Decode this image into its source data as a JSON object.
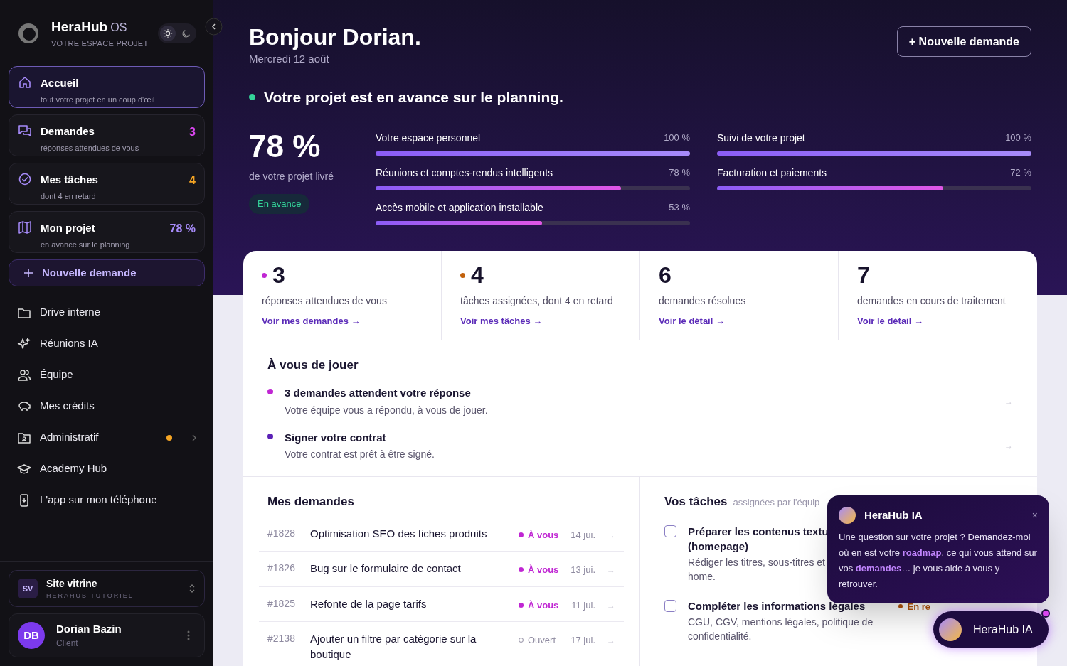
{
  "brand": {
    "name": "HeraHub",
    "suffix": "OS",
    "tagline": "VOTRE ESPACE PROJET"
  },
  "theme_toggle": [
    {
      "selected": true
    },
    {
      "selected": false
    }
  ],
  "nav_cards": [
    {
      "label": "Accueil",
      "sub": "tout votre projet en un coup d'œil",
      "selected": true
    },
    {
      "label": "Demandes",
      "sub": "réponses attendues de vous",
      "badge": "3",
      "color": "#d946ef",
      "selected": false
    },
    {
      "label": "Mes tâches",
      "sub": "dont 4 en retard",
      "badge": "4",
      "color": "#f5a524",
      "selected": false
    },
    {
      "label": "Mon projet",
      "sub": "en avance sur le planning",
      "badge": "78 %",
      "color": "#a78bfa",
      "selected": false
    }
  ],
  "new_request_button": "Nouvelle demande",
  "nav_items": [
    {
      "label": "Drive interne"
    },
    {
      "label": "Réunions IA"
    },
    {
      "label": "Équipe"
    },
    {
      "label": "Mes crédits"
    },
    {
      "label": "Administratif",
      "alert": true
    },
    {
      "label": "Academy Hub"
    },
    {
      "label": "L'app sur mon téléphone"
    }
  ],
  "workspace": {
    "initials": "SV",
    "name": "Site vitrine",
    "sub": "HERAHUB TUTORIEL"
  },
  "user": {
    "initials": "DB",
    "name": "Dorian Bazin",
    "role": "Client"
  },
  "header": {
    "greeting": "Bonjour Dorian.",
    "date": "Mercredi 12 août",
    "action": "+ Nouvelle demande",
    "status": "Votre projet est en avance sur le planning."
  },
  "progress": {
    "value": "78 %",
    "label": "de votre projet livré",
    "badge": "En avance",
    "columns": [
      [
        {
          "name": "Votre espace personnel",
          "reading": "100 %",
          "level": 1
        },
        {
          "name": "Réunions et comptes-rendus intelligents",
          "reading": "78 %",
          "level": 0.78
        },
        {
          "name": "Accès mobile et application installable",
          "reading": "53 %",
          "level": 0.53
        }
      ],
      [
        {
          "name": "Suivi de votre projet",
          "reading": "100 %",
          "level": 1
        },
        {
          "name": "Facturation et paiements",
          "reading": "72 %",
          "level": 0.72
        }
      ]
    ]
  },
  "stats": [
    {
      "value": "3",
      "label": "réponses attendues de vous",
      "link": "Voir mes demandes →",
      "color": "#c026d3"
    },
    {
      "value": "4",
      "label": "tâches assignées, dont 4 en retard",
      "link": "Voir mes tâches →",
      "color": "#c2610c"
    },
    {
      "value": "6",
      "label": "demandes résolues",
      "link": "Voir le détail →"
    },
    {
      "value": "7",
      "label": "demandes en cours de traitement",
      "link": "Voir le détail →"
    }
  ],
  "todo": {
    "title": "À vous de jouer",
    "items": [
      {
        "title": "3 demandes attendent votre réponse",
        "sub": "Votre équipe vous a répondu, à vous de jouer.",
        "color": "#c026d3",
        "arrow": "→"
      },
      {
        "title": "Signer votre contrat",
        "sub": "Votre contrat est prêt à être signé.",
        "color": "#5b21b6",
        "arrow": "→"
      }
    ]
  },
  "requests": {
    "title": "Mes demandes",
    "rows": [
      {
        "id": "#1828",
        "title": "Optimisation SEO des fiches produits",
        "status": "À vous",
        "kind": "mine",
        "date": "14 jui.",
        "arrow": "→"
      },
      {
        "id": "#1826",
        "title": "Bug sur le formulaire de contact",
        "status": "À vous",
        "kind": "mine",
        "date": "13 jui.",
        "arrow": "→"
      },
      {
        "id": "#1825",
        "title": "Refonte de la page tarifs",
        "status": "À vous",
        "kind": "mine",
        "date": "11 jui.",
        "arrow": "→"
      },
      {
        "id": "#2138",
        "title": "Ajouter un filtre par catégorie sur la boutique",
        "status": "Ouvert",
        "kind": "open",
        "date": "17 jul.",
        "arrow": "→"
      }
    ]
  },
  "tasks": {
    "title": "Vos tâches",
    "sub": "assignées par l'équip",
    "items": [
      {
        "title_lines": [
          "Préparer les contenus textu",
          "(homepage)"
        ],
        "desc_lines": [
          "Rédiger les titres, sous-titres et",
          "home."
        ],
        "checked": false
      },
      {
        "title_lines": [
          "Compléter les informations légales"
        ],
        "desc_lines": [
          "CGU, CGV, mentions légales, politique de",
          "confidentialité."
        ],
        "checked": false,
        "status": "En re"
      }
    ]
  },
  "assistant": {
    "name": "HeraHub IA",
    "message": "Une question sur votre projet ? Demandez-moi où en est votre **roadmap**, ce qui vous attend sur vos **demandes**… je vous aide à vous y retrouver.",
    "close": "×",
    "button": "HeraHub IA"
  }
}
